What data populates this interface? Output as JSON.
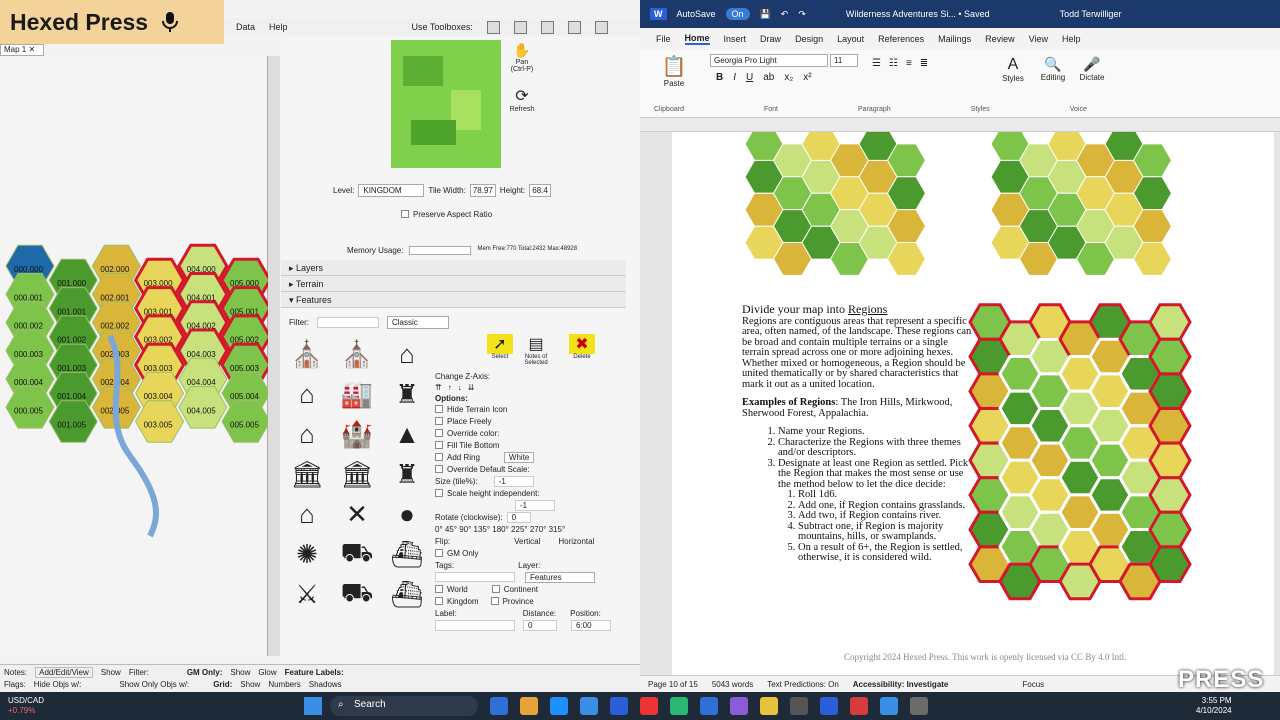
{
  "brand": {
    "title": "Hexed Press",
    "mic_icon": "microphone-icon"
  },
  "left_menu": {
    "data": "Data",
    "help": "Help",
    "use_toolboxes": "Use Toolboxes:"
  },
  "map_tab": "Map 1",
  "hex_labels": [
    "000.000",
    "001.000",
    "002.000",
    "003.000",
    "004.000",
    "005.000",
    "000.001",
    "001.001",
    "002.001",
    "003.001",
    "004.001",
    "005.001",
    "000.002",
    "001.002",
    "002.002",
    "003.002",
    "004.002",
    "005.002",
    "000.003",
    "001.003",
    "002.003",
    "003.003",
    "004.003",
    "005.003",
    "000.004",
    "001.004",
    "002.004",
    "003.004",
    "004.004",
    "005.004",
    "000.005",
    "001.005",
    "002.005",
    "003.005",
    "004.005",
    "005.005"
  ],
  "controls": {
    "pan": "Pan",
    "pan_hint": "(Ctrl-P)",
    "refresh": "Refresh",
    "level_label": "Level:",
    "level_value": "KINGDOM",
    "tile_width_label": "Tile Width:",
    "tile_width": "78.97",
    "height_label": "Height:",
    "height_value": "68.4",
    "preserve": "Preserve Aspect Ratio",
    "memory_label": "Memory Usage:",
    "memory_info": "Mem Free:770 Total:2432 Max:48928"
  },
  "sections": {
    "layers": "Layers",
    "terrain": "Terrain",
    "features": "Features"
  },
  "features": {
    "filter_label": "Filter:",
    "style_value": "Classic",
    "select": "Select",
    "notes": "Notes of Selected",
    "delete": "Delete",
    "change_z": "Change Z-Axis:",
    "options": "Options:",
    "hide_terrain": "Hide Terrain Icon",
    "place_freely": "Place Freely",
    "override_color": "Override color:",
    "fill_tile_bottom": "Fill Tile Bottom",
    "add_ring": "Add Ring",
    "ring_color": "White",
    "override_scale": "Override Default Scale:",
    "size_label": "Size (tile%):",
    "size_value": "-1",
    "scale_height": "Scale height independent:",
    "scale_value": "-1",
    "rotate_label": "Rotate (clockwise):",
    "rotate_value": "0",
    "rotations": "0°  45°  90°  135°  180°  225°  270°  315°",
    "flip_label": "Flip:",
    "vertical": "Vertical",
    "horizontal": "Horizontal",
    "gm_only": "GM Only",
    "tags_label": "Tags:",
    "layer_label": "Layer:",
    "layer_value": "Features",
    "world": "World",
    "continent": "Continent",
    "kingdom": "Kingdom",
    "province": "Province",
    "label_label": "Label:",
    "distance_label": "Distance:",
    "distance_value": "0",
    "position_label": "Position:",
    "position_value": "6:00"
  },
  "status_left": {
    "notes": "Notes:",
    "add_edit": "Add/Edit/View",
    "show": "Show",
    "filter": "Filter:",
    "gm_only": "GM Only:",
    "show2": "Show",
    "glow": "Glow",
    "feature_labels": "Feature Labels:",
    "flags": "Flags:",
    "hide_objs": "Hide Objs w/:",
    "show_only": "Show Only Objs w/:",
    "grid": "Grid:",
    "show3": "Show",
    "numbers": "Numbers",
    "shadows": "Shadows"
  },
  "word": {
    "autosave": "AutoSave",
    "on": "On",
    "doc_title": "Wilderness Adventures Si... • Saved",
    "user": "Todd Terwilliger",
    "menu": [
      "File",
      "Home",
      "Insert",
      "Draw",
      "Design",
      "Layout",
      "References",
      "Mailings",
      "Review",
      "View",
      "Help"
    ],
    "font": "Georgia Pro Light",
    "size": "11",
    "paste": "Paste",
    "styles": "Styles",
    "editing": "Editing",
    "dictate": "Dictate",
    "clipboard": "Clipboard",
    "font_group": "Font",
    "paragraph": "Paragraph",
    "styles_group": "Styles",
    "voice": "Voice"
  },
  "doc": {
    "heading_a": "Divide your map into ",
    "heading_b": "Regions",
    "p1": "Regions are contiguous areas that represent a specific area, often named, of the landscape. These regions can be broad and contain multiple terrains or a single terrain spread across one or more adjoining hexes. Whether mixed or homogeneous, a Region should be united thematically or by shared characteristics that mark it out as a united location.",
    "ex_label": "Examples of Regions",
    "ex_text": ": The Iron Hills, Mirkwood, Sherwood Forest, Appalachia.",
    "steps": [
      "Name your Regions.",
      "Characterize the Regions with three themes and/or descriptors.",
      "Designate at least one Region as settled. Pick the Region that makes the most sense or use the method below to let the dice decide:"
    ],
    "substeps": [
      "Roll 1d6.",
      "Add one, if Region contains grasslands.",
      "Add two, if Region contains river.",
      "Subtract one, if Region is majority mountains, hills, or swamplands.",
      "On a result of 6+, the Region is settled, otherwise, it is considered wild."
    ],
    "copyright": "Copyright 2024 Hexed Press. This work is openly licensed via CC By 4.0 Intl."
  },
  "word_status": {
    "page": "Page 10 of 15",
    "words": "5043 words",
    "predictions": "Text Predictions: On",
    "accessibility": "Accessibility: Investigate",
    "focus": "Focus"
  },
  "taskbar": {
    "ticker": "USD/CAD",
    "change": "+0.79%",
    "search": "Search",
    "time": "3:55 PM",
    "date": "4/10/2024"
  },
  "watermark": "PRESS"
}
